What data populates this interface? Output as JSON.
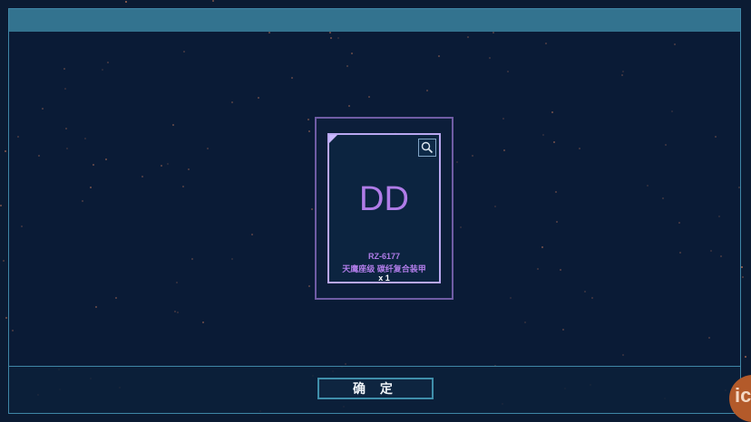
{
  "item": {
    "glyph": "DD",
    "code": "RZ-6177",
    "name": "天鹰座级 碳纤复合装甲",
    "quantity": "x 1"
  },
  "confirm_label": "确 定",
  "logo_text": "ic",
  "icons": {
    "search": "search-icon"
  },
  "colors": {
    "background": "#0b1b33",
    "top_bar": "#33738f",
    "frame_border": "#3f86a6",
    "card_border": "#6f5ca4",
    "item_text": "#b07ce8"
  }
}
